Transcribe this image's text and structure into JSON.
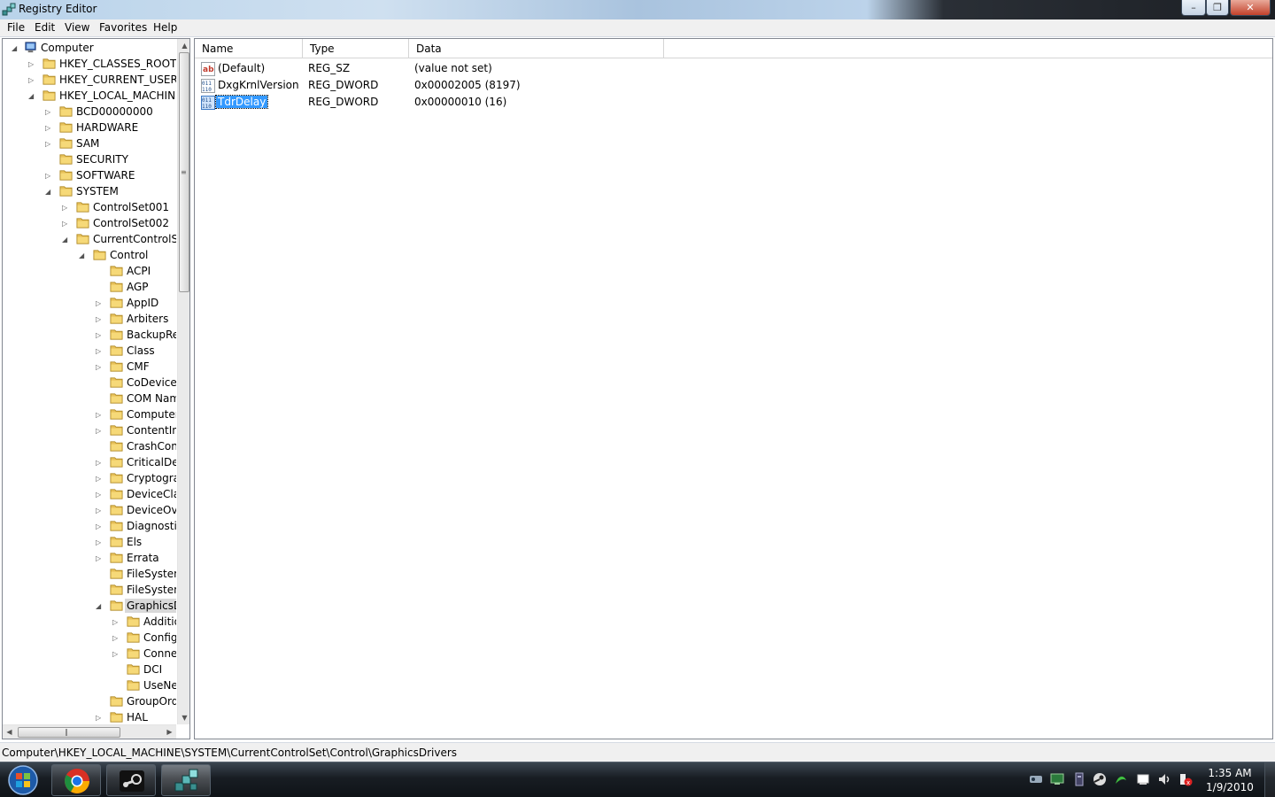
{
  "window": {
    "title": "Registry Editor"
  },
  "menu": [
    "File",
    "Edit",
    "View",
    "Favorites",
    "Help"
  ],
  "tree": [
    {
      "label": "Computer",
      "level": 0,
      "expander": "open",
      "icon": "computer-icon"
    },
    {
      "label": "HKEY_CLASSES_ROOT",
      "level": 1,
      "expander": "closed"
    },
    {
      "label": "HKEY_CURRENT_USER",
      "level": 1,
      "expander": "closed"
    },
    {
      "label": "HKEY_LOCAL_MACHINE",
      "level": 1,
      "expander": "open"
    },
    {
      "label": "BCD00000000",
      "level": 2,
      "expander": "closed"
    },
    {
      "label": "HARDWARE",
      "level": 2,
      "expander": "closed"
    },
    {
      "label": "SAM",
      "level": 2,
      "expander": "closed"
    },
    {
      "label": "SECURITY",
      "level": 2,
      "expander": "none"
    },
    {
      "label": "SOFTWARE",
      "level": 2,
      "expander": "closed"
    },
    {
      "label": "SYSTEM",
      "level": 2,
      "expander": "open"
    },
    {
      "label": "ControlSet001",
      "level": 3,
      "expander": "closed"
    },
    {
      "label": "ControlSet002",
      "level": 3,
      "expander": "closed"
    },
    {
      "label": "CurrentControlSet",
      "level": 3,
      "expander": "open"
    },
    {
      "label": "Control",
      "level": 4,
      "expander": "open"
    },
    {
      "label": "ACPI",
      "level": 5,
      "expander": "none"
    },
    {
      "label": "AGP",
      "level": 5,
      "expander": "none"
    },
    {
      "label": "AppID",
      "level": 5,
      "expander": "closed"
    },
    {
      "label": "Arbiters",
      "level": 5,
      "expander": "closed"
    },
    {
      "label": "BackupRes",
      "level": 5,
      "expander": "closed"
    },
    {
      "label": "Class",
      "level": 5,
      "expander": "closed"
    },
    {
      "label": "CMF",
      "level": 5,
      "expander": "closed"
    },
    {
      "label": "CoDeviceIr",
      "level": 5,
      "expander": "none"
    },
    {
      "label": "COM Nam",
      "level": 5,
      "expander": "none"
    },
    {
      "label": "Computerl",
      "level": 5,
      "expander": "closed"
    },
    {
      "label": "ContentInc",
      "level": 5,
      "expander": "closed"
    },
    {
      "label": "CrashCont",
      "level": 5,
      "expander": "none"
    },
    {
      "label": "CriticalDev",
      "level": 5,
      "expander": "closed"
    },
    {
      "label": "Cryptograp",
      "level": 5,
      "expander": "closed"
    },
    {
      "label": "DeviceClas",
      "level": 5,
      "expander": "closed"
    },
    {
      "label": "DeviceOve",
      "level": 5,
      "expander": "closed"
    },
    {
      "label": "Diagnostic",
      "level": 5,
      "expander": "closed"
    },
    {
      "label": "Els",
      "level": 5,
      "expander": "closed"
    },
    {
      "label": "Errata",
      "level": 5,
      "expander": "closed"
    },
    {
      "label": "FileSystem",
      "level": 5,
      "expander": "none"
    },
    {
      "label": "FileSystem",
      "level": 5,
      "expander": "none"
    },
    {
      "label": "GraphicsDr",
      "level": 5,
      "expander": "open",
      "selected": true
    },
    {
      "label": "Additio",
      "level": 6,
      "expander": "closed"
    },
    {
      "label": "Config",
      "level": 6,
      "expander": "closed"
    },
    {
      "label": "Connec",
      "level": 6,
      "expander": "closed"
    },
    {
      "label": "DCI",
      "level": 6,
      "expander": "none"
    },
    {
      "label": "UseNev",
      "level": 6,
      "expander": "none"
    },
    {
      "label": "GroupOrde",
      "level": 5,
      "expander": "none"
    },
    {
      "label": "HAL",
      "level": 5,
      "expander": "closed"
    }
  ],
  "list": {
    "columns": [
      "Name",
      "Type",
      "Data"
    ],
    "rows": [
      {
        "name": "(Default)",
        "type": "REG_SZ",
        "data": "(value not set)",
        "icon": "string-value-icon"
      },
      {
        "name": "DxgKrnlVersion",
        "type": "REG_DWORD",
        "data": "0x00002005 (8197)",
        "icon": "dword-value-icon"
      },
      {
        "name": "TdrDelay",
        "type": "REG_DWORD",
        "data": "0x00000010 (16)",
        "icon": "dword-value-icon",
        "selected": true
      }
    ]
  },
  "status": {
    "path": "Computer\\HKEY_LOCAL_MACHINE\\SYSTEM\\CurrentControlSet\\Control\\GraphicsDrivers"
  },
  "taskbar": {
    "apps": [
      "chrome-icon",
      "steam-icon",
      "regedit-icon"
    ],
    "tray": [
      "network-tray-icon",
      "monitor-tray-icon",
      "device-tray-icon",
      "steam-tray-icon",
      "razer-tray-icon",
      "flag-tray-icon",
      "volume-icon",
      "action-center-icon"
    ],
    "time": "1:35 AM",
    "date": "1/9/2010"
  }
}
